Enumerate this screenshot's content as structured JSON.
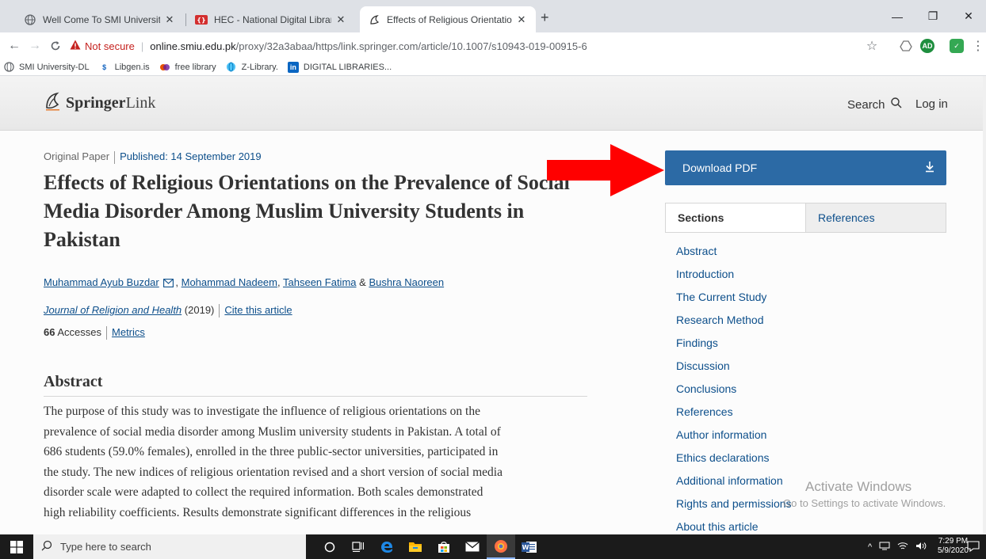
{
  "browser": {
    "tabs": [
      {
        "title": "Well Come To SMI University..."
      },
      {
        "title": "HEC - National Digital Library - P"
      },
      {
        "title": "Effects of Religious Orientations"
      }
    ],
    "url": {
      "insecure_label": "Not secure",
      "host": "online.smiu.edu.pk",
      "path": "/proxy/32a3abaa/https/link.springer.com/article/10.1007/s10943-019-00915-6"
    },
    "extension_label": "AD",
    "bookmarks": [
      {
        "label": "SMI University-DL",
        "icon": "globe-icon"
      },
      {
        "label": "Libgen.is",
        "icon": "libgen-icon"
      },
      {
        "label": "free library",
        "icon": "library-icon"
      },
      {
        "label": "Z-Library.",
        "icon": "globe-icon"
      },
      {
        "label": "DIGITAL LIBRARIES...",
        "icon": "linkedin-icon"
      }
    ]
  },
  "site": {
    "brand_bold": "Springer",
    "brand_rest": "Link",
    "search_label": "Search",
    "login_label": "Log in"
  },
  "article": {
    "type": "Original Paper",
    "published": "Published: 14 September 2019",
    "title": "Effects of Religious Orientations on the Prevalence of Social Media Disorder Among Muslim University Students in Pakistan",
    "authors": [
      {
        "name": "Muhammad Ayub Buzdar"
      },
      {
        "name": "Mohammad Nadeem"
      },
      {
        "name": "Tahseen Fatima"
      },
      {
        "name": "Bushra Naoreen"
      }
    ],
    "author_sep_comma": ",",
    "author_sep_amp": "&",
    "journal": "Journal of Religion and Health",
    "year": "(2019)",
    "cite_label": "Cite this article",
    "accesses_count": "66",
    "accesses_label": "Accesses",
    "metrics_label": "Metrics",
    "abstract_heading": "Abstract",
    "abstract_lines": [
      "The purpose of this study was to investigate the influence of religious orientations on the",
      "prevalence of social media disorder among Muslim university students in Pakistan. A total of",
      "686 students (59.0% females), enrolled in the three public-sector universities, participated in",
      "the study. The new indices of religious orientation revised and a short version of social media",
      "disorder scale were adapted to collect the required information. Both scales demonstrated",
      "high reliability coefficients. Results demonstrate significant differences in the religious"
    ]
  },
  "sidebar": {
    "download_label": "Download PDF",
    "tabs": [
      {
        "label": "Sections"
      },
      {
        "label": "References"
      }
    ],
    "sections": [
      "Abstract",
      "Introduction",
      "The Current Study",
      "Research Method",
      "Findings",
      "Discussion",
      "Conclusions",
      "References",
      "Author information",
      "Ethics declarations",
      "Additional information",
      "Rights and permissions",
      "About this article"
    ]
  },
  "watermark": {
    "line1": "Activate Windows",
    "line2": "Go to Settings to activate Windows."
  },
  "taskbar": {
    "search_placeholder": "Type here to search",
    "time": "7:29 PM",
    "date": "5/9/2020"
  },
  "colors": {
    "springer_blue": "#0d4f8b",
    "download_button": "#2c6aa5",
    "annotation_arrow": "#ff0000"
  }
}
